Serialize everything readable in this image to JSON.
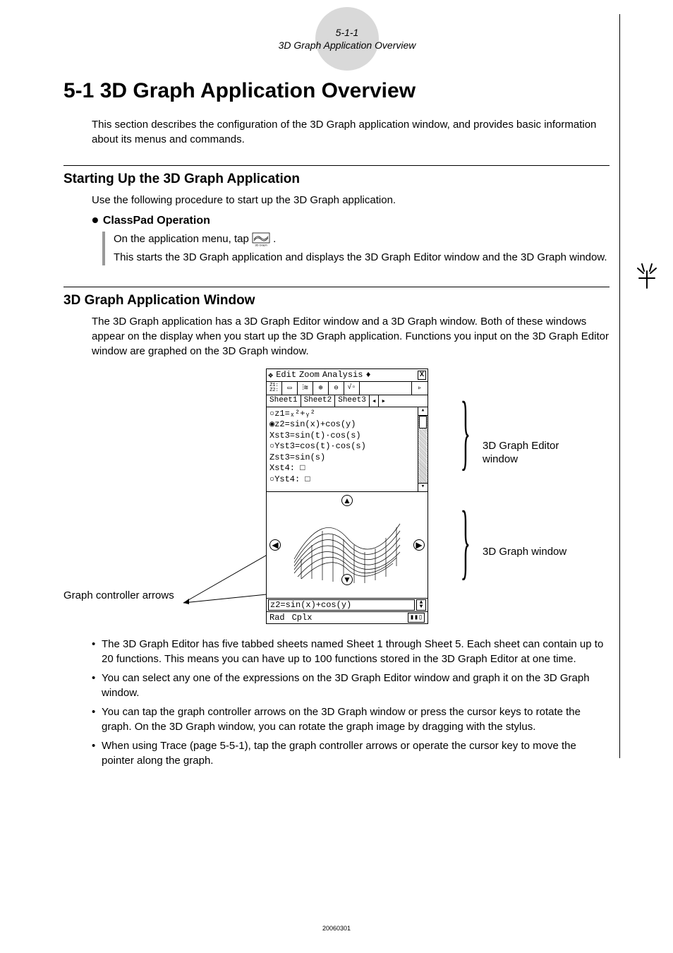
{
  "header": {
    "page_num": "5-1-1",
    "subtitle": "3D Graph Application Overview"
  },
  "title": "5-1 3D Graph Application Overview",
  "intro": "This section describes the configuration of the 3D Graph application window, and provides basic information about its menus and commands.",
  "section1": {
    "heading": "Starting Up the 3D Graph Application",
    "lead": "Use the following procedure to start up the 3D Graph application.",
    "subheading": "ClassPad Operation",
    "step1_pre": "On the application menu, tap ",
    "step1_post": ".",
    "step2": "This starts the 3D Graph application and displays the 3D Graph Editor window and the 3D Graph window."
  },
  "section2": {
    "heading": "3D Graph Application Window",
    "lead": "The 3D Graph application has a 3D Graph Editor window and a 3D Graph window. Both of these windows appear on the display when you start up the 3D Graph application. Functions you input on the 3D Graph Editor window are graphed on the 3D Graph window."
  },
  "screenshot": {
    "menu": {
      "edit": "Edit",
      "zoom": "Zoom",
      "analysis": "Analysis",
      "diamond": "♦"
    },
    "toolbar_first": "Z1:…\nZ2:…",
    "tabs": {
      "s1": "Sheet1",
      "s2": "Sheet2",
      "s3": "Sheet3"
    },
    "editor_lines": [
      "○z1=ₓ²+ᵧ²",
      "◉z2=sin(x)+cos(y)",
      "  Xst3=sin(t)·cos(s)",
      "○Yst3=cos(t)·cos(s)",
      "  Zst3=sin(s)",
      "  Xst4: □",
      "○Yst4: □"
    ],
    "formula": "z2=sin(x)+cos(y)",
    "status": {
      "rad": "Rad",
      "cplx": "Cplx"
    }
  },
  "labels": {
    "editor_window": "3D Graph Editor window",
    "graph_window": "3D Graph window",
    "controller": "Graph controller arrows"
  },
  "notes": [
    "The 3D Graph Editor has five tabbed sheets named Sheet 1 through Sheet 5. Each sheet can contain up to 20 functions. This means you can have up to 100 functions stored in the 3D Graph Editor at one time.",
    "You can select any one of the expressions on the 3D Graph Editor window and graph it on the 3D Graph window.",
    "You can tap the graph controller arrows on the 3D Graph window or press the cursor keys to rotate the graph. On the 3D Graph window, you can rotate the graph image by dragging with the stylus.",
    "When using Trace (page 5-5-1), tap the graph controller arrows or operate the cursor key to move the pointer along the graph."
  ],
  "footer": "20060301"
}
